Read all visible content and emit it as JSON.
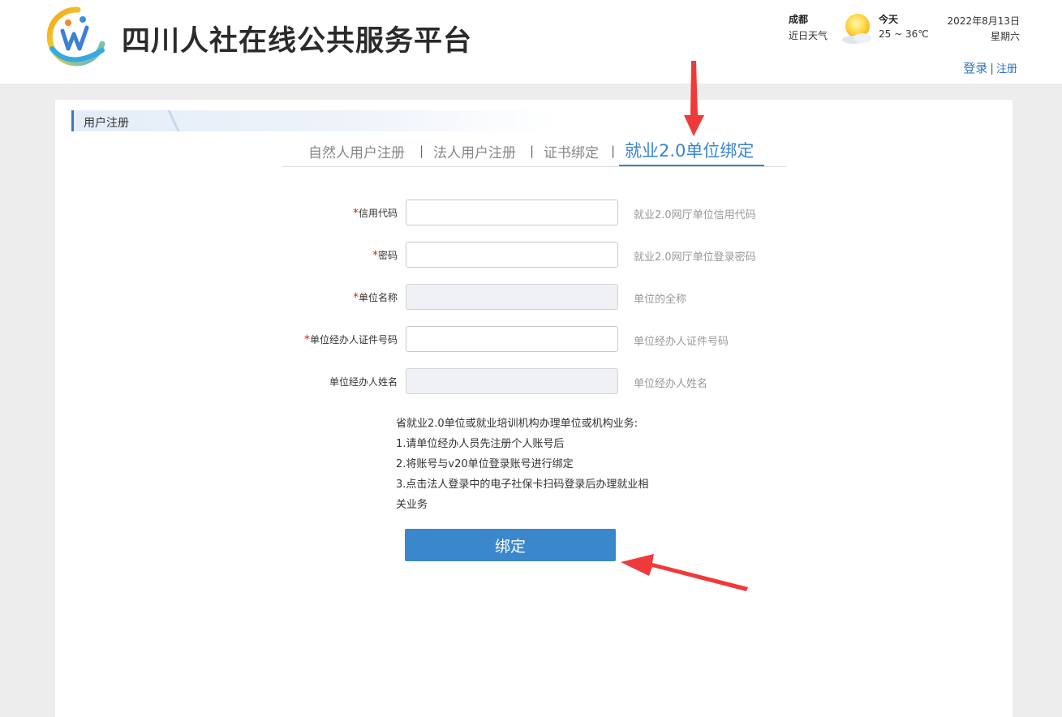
{
  "header": {
    "site_title": "四川人社在线公共服务平台",
    "weather": {
      "city": "成都",
      "label": "近日天气",
      "day": "今天",
      "temperature": "25 ~ 36℃",
      "icon": "sun-cloud-icon"
    },
    "date": "2022年8月13日",
    "weekday": "星期六",
    "auth": {
      "login": "登录",
      "separator": "|",
      "register": "注册"
    }
  },
  "section": {
    "title": "用户注册"
  },
  "tabs": [
    {
      "label": "自然人用户注册",
      "active": false
    },
    {
      "label": "法人用户注册",
      "active": false
    },
    {
      "label": "证书绑定",
      "active": false
    },
    {
      "label": "就业2.0单位绑定",
      "active": true
    }
  ],
  "tab_separator": "|",
  "form": {
    "required_mark": "*",
    "fields": [
      {
        "label": "信用代码",
        "required": true,
        "value": "",
        "hint": "就业2.0网厅单位信用代码",
        "disabled": false
      },
      {
        "label": "密码",
        "required": true,
        "value": "",
        "hint": "就业2.0网厅单位登录密码",
        "disabled": false
      },
      {
        "label": "单位名称",
        "required": true,
        "value": "",
        "hint": "单位的全称",
        "disabled": true
      },
      {
        "label": "单位经办人证件号码",
        "required": true,
        "value": "",
        "hint": "单位经办人证件号码",
        "disabled": false
      },
      {
        "label": "单位经办人姓名",
        "required": false,
        "value": "",
        "hint": "单位经办人姓名",
        "disabled": true
      }
    ],
    "notes": [
      "省就业2.0单位或就业培训机构办理单位或机构业务:",
      "1.请单位经办人员先注册个人账号后",
      "2.将账号与v20单位登录账号进行绑定",
      "3.点击法人登录中的电子社保卡扫码登录后办理就业相",
      "关业务"
    ],
    "submit_label": "绑定"
  },
  "colors": {
    "accent": "#3a84cf",
    "button": "#3b87cb",
    "required": "#e02020",
    "arrow": "#f03a3a"
  }
}
